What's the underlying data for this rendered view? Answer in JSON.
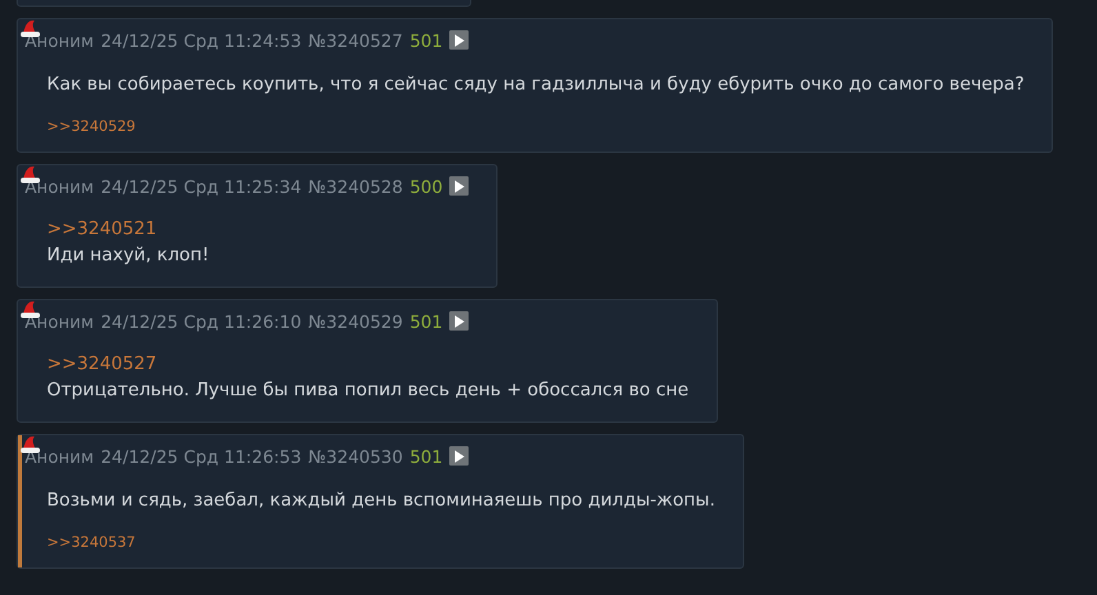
{
  "posts": [
    {
      "name": "Аноним",
      "date": "24/12/25 Срд 11:24:53",
      "number": "№3240527",
      "count": "501",
      "highlighted": false,
      "text": "Как вы собираетесь коупить, что я сейчас сяду на гадзиллыча и буду ебурить очко до самого вечера?",
      "replies": [
        ">>3240529"
      ]
    },
    {
      "name": "Аноним",
      "date": "24/12/25 Срд 11:25:34",
      "number": "№3240528",
      "count": "500",
      "highlighted": false,
      "quote": ">>3240521",
      "text": "Иди нахуй, клоп!"
    },
    {
      "name": "Аноним",
      "date": "24/12/25 Срд 11:26:10",
      "number": "№3240529",
      "count": "501",
      "highlighted": false,
      "quote": ">>3240527",
      "text": "Отрицательно. Лучше бы пива попил весь день + обоссался во сне"
    },
    {
      "name": "Аноним",
      "date": "24/12/25 Срд 11:26:53",
      "number": "№3240530",
      "count": "501",
      "highlighted": true,
      "text": "Возьми и сядь, заебал, каждый день вспоминаяешь про дилды-жопы.",
      "replies": [
        ">>3240537"
      ]
    }
  ]
}
